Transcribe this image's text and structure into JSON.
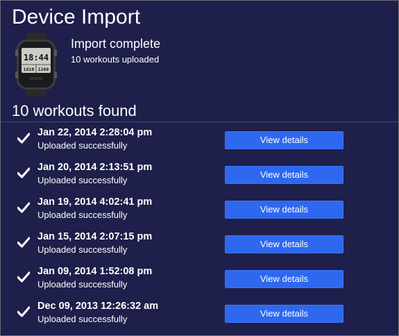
{
  "page": {
    "title": "Device Import",
    "status_headline": "Import complete",
    "status_detail": "10 workouts uploaded",
    "found_heading": "10 workouts found"
  },
  "device": {
    "icon": "garmin-watch-icon",
    "screen_time": "18:44",
    "screen_left": "1810",
    "screen_right": "1260"
  },
  "colors": {
    "background": "#1e1f4a",
    "button": "#2d68ef",
    "text": "#ffffff"
  },
  "workouts": [
    {
      "date": "Jan 22, 2014 2:28:04 pm",
      "status": "Uploaded successfully",
      "button": "View details"
    },
    {
      "date": "Jan 20, 2014 2:13:51 pm",
      "status": "Uploaded successfully",
      "button": "View details"
    },
    {
      "date": "Jan 19, 2014 4:02:41 pm",
      "status": "Uploaded successfully",
      "button": "View details"
    },
    {
      "date": "Jan 15, 2014 2:07:15 pm",
      "status": "Uploaded successfully",
      "button": "View details"
    },
    {
      "date": "Jan 09, 2014 1:52:08 pm",
      "status": "Uploaded successfully",
      "button": "View details"
    },
    {
      "date": "Dec 09, 2013 12:26:32 am",
      "status": "Uploaded successfully",
      "button": "View details"
    }
  ]
}
